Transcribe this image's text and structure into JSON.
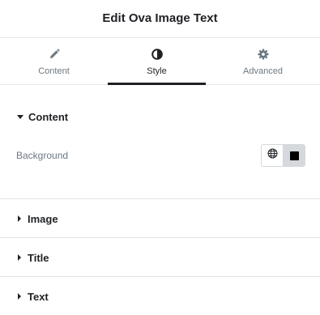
{
  "header": {
    "title": "Edit Ova Image Text"
  },
  "tabs": [
    {
      "label": "Content",
      "icon": "pencil-icon",
      "active": false
    },
    {
      "label": "Style",
      "icon": "half-circle-icon",
      "active": true
    },
    {
      "label": "Advanced",
      "icon": "gear-icon",
      "active": false
    }
  ],
  "sections": [
    {
      "label": "Content",
      "expanded": true,
      "controls": [
        {
          "label": "Background",
          "options": [
            "globe-icon",
            "color-square-icon"
          ],
          "selected": "color-square-icon",
          "swatch_color": "#000000"
        }
      ]
    },
    {
      "label": "Image",
      "expanded": false
    },
    {
      "label": "Title",
      "expanded": false
    },
    {
      "label": "Text",
      "expanded": false
    }
  ],
  "colors": {
    "text": "#1f2124",
    "muted": "#6d7882",
    "border": "#e6e8ea",
    "accent": "#1f2124"
  }
}
